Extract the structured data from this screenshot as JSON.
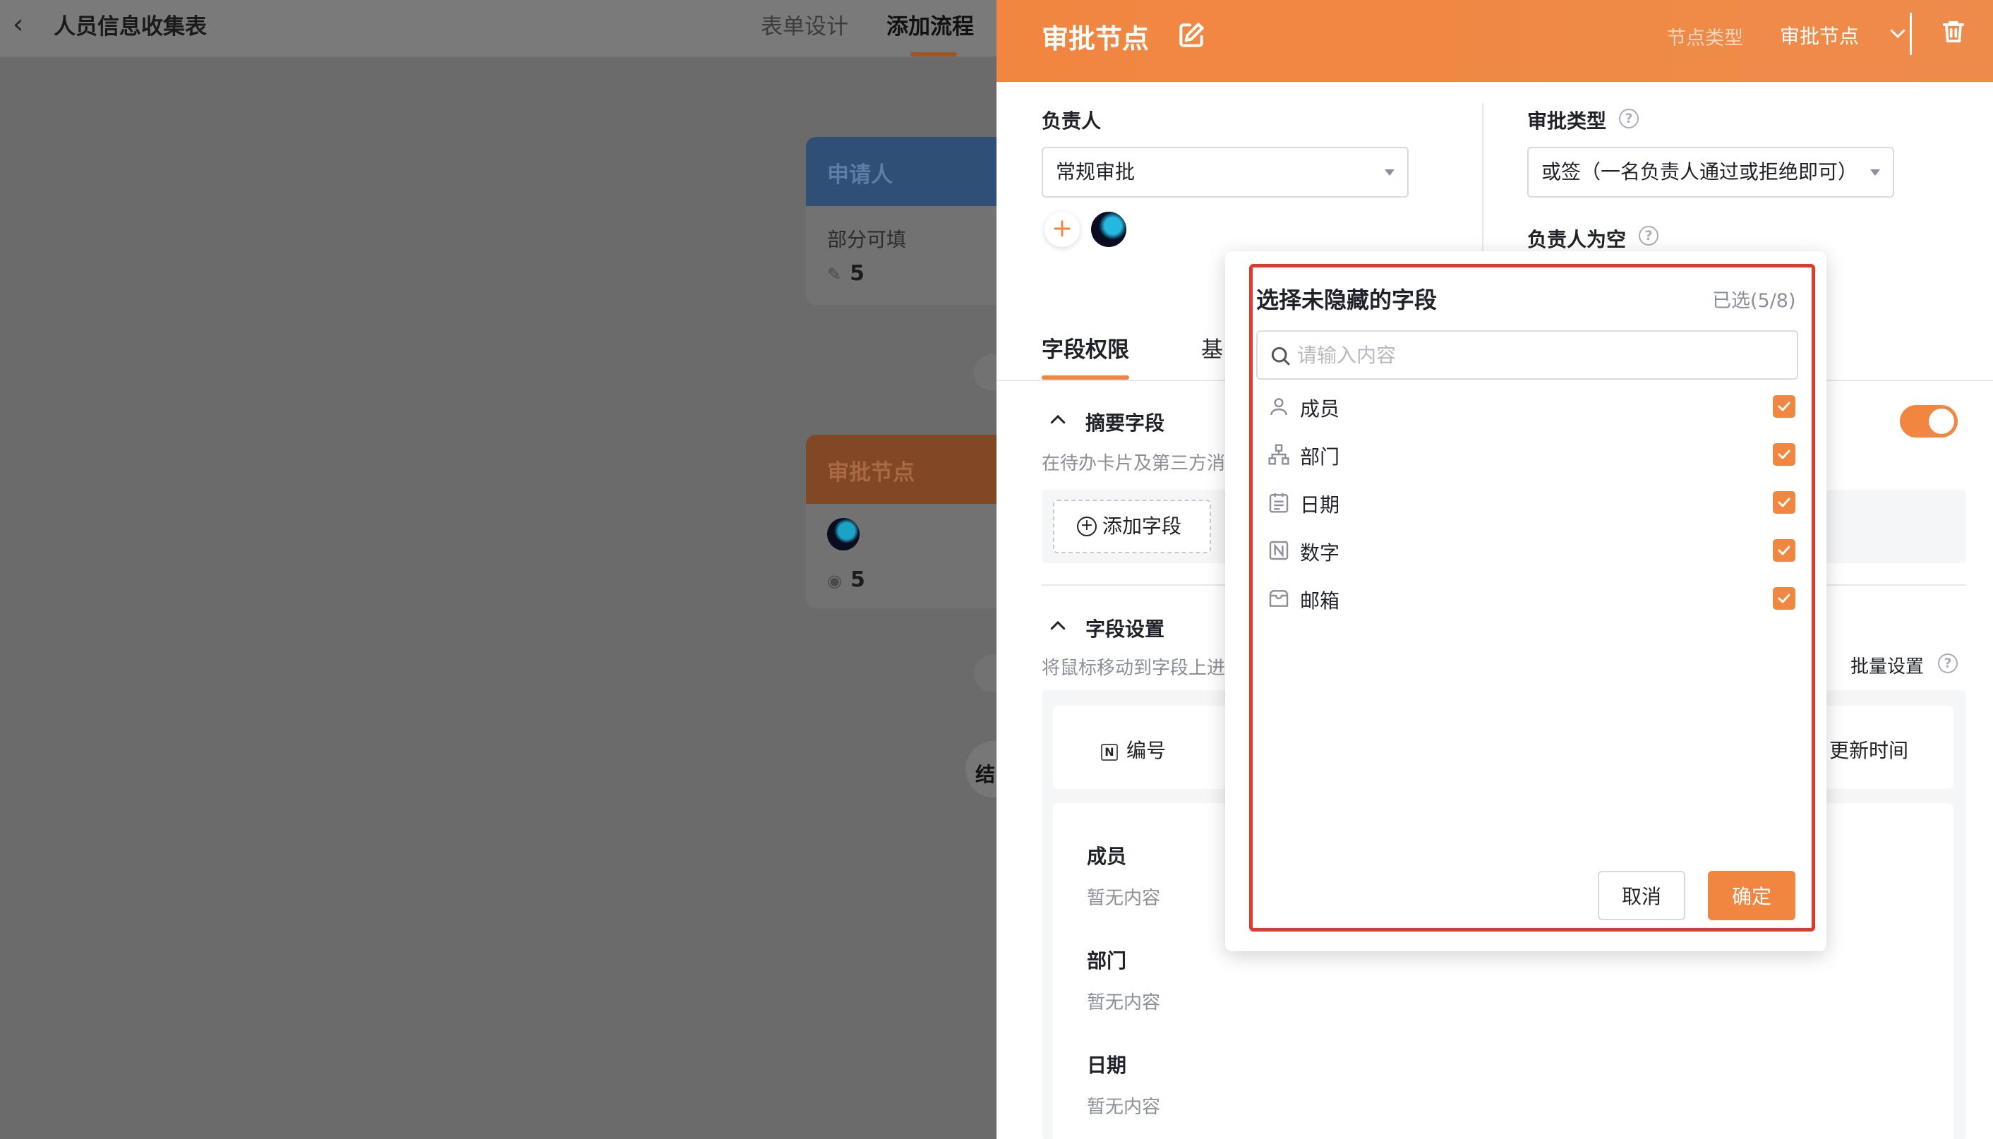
{
  "header": {
    "back_icon": "chevron-left-icon",
    "form_title": "人员信息收集表",
    "tabs": [
      {
        "label": "表单设计",
        "active": false
      },
      {
        "label": "添加流程",
        "active": true
      }
    ]
  },
  "canvas": {
    "applicant_node": {
      "title": "申请人",
      "subtitle": "部分可填",
      "count": "5",
      "count_icon": "pencil-icon"
    },
    "approval_node": {
      "title": "审批节点",
      "count": "5",
      "count_icon": "eye-icon"
    },
    "end_label": "结"
  },
  "drawer": {
    "title": "审批节点",
    "node_type_label": "节点类型",
    "node_type_value": "审批节点",
    "assignee": {
      "label": "负责人",
      "select_value": "常规审批"
    },
    "approval_type": {
      "label": "审批类型",
      "select_value": "或签（一名负责人通过或拒绝即可）"
    },
    "assignee_empty_label": "负责人为空",
    "tabs": [
      {
        "label": "字段权限",
        "active": true
      },
      {
        "label": "基",
        "active": false
      }
    ],
    "summary_section": {
      "title": "摘要字段",
      "desc": "在待办卡片及第三方消",
      "add_button": "添加字段",
      "toggle_on": true
    },
    "field_settings": {
      "title": "字段设置",
      "desc": "将鼠标移动到字段上进",
      "batch_label": "批量设置",
      "header_id": "编号",
      "header_update": "更新时间",
      "rows": [
        {
          "name": "成员",
          "value": "暂无内容"
        },
        {
          "name": "部门",
          "value": "暂无内容"
        },
        {
          "name": "日期",
          "value": "暂无内容"
        }
      ]
    }
  },
  "popup": {
    "title": "选择未隐藏的字段",
    "selected_count": "已选(5/8)",
    "search_placeholder": "请输入内容",
    "options": [
      {
        "label": "成员",
        "icon": "person-icon",
        "checked": true
      },
      {
        "label": "部门",
        "icon": "org-chart-icon",
        "checked": true
      },
      {
        "label": "日期",
        "icon": "calendar-icon",
        "checked": true
      },
      {
        "label": "数字",
        "icon": "number-icon",
        "checked": true
      },
      {
        "label": "邮箱",
        "icon": "mailbox-icon",
        "checked": true
      }
    ],
    "cancel_label": "取消",
    "confirm_label": "确定"
  },
  "colors": {
    "accent": "#f08640",
    "highlight_frame": "#e03a2f"
  }
}
